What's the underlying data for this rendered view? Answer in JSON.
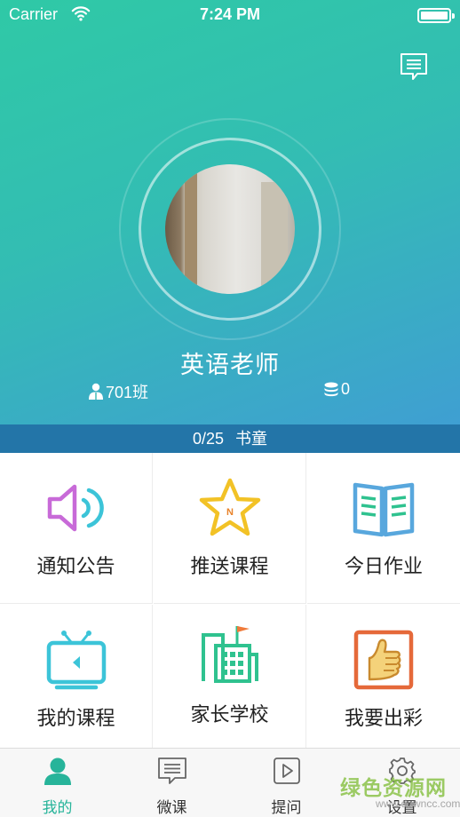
{
  "status_bar": {
    "carrier": "Carrier",
    "time": "7:24 PM"
  },
  "profile": {
    "name": "英语老师",
    "class_label": "701班",
    "coins": "0"
  },
  "progress": {
    "value": "0/25",
    "label": "书童"
  },
  "grid": [
    {
      "label": "通知公告",
      "icon": "speaker-icon"
    },
    {
      "label": "推送课程",
      "icon": "star-icon"
    },
    {
      "label": "今日作业",
      "icon": "open-book-icon"
    },
    {
      "label": "我的课程",
      "icon": "tv-icon"
    },
    {
      "label": "家长学校",
      "icon": "school-building-icon"
    },
    {
      "label": "我要出彩",
      "icon": "thumbs-up-icon"
    }
  ],
  "tabs": [
    {
      "label": "我的",
      "icon": "person-icon",
      "active": true
    },
    {
      "label": "微课",
      "icon": "message-icon",
      "active": false
    },
    {
      "label": "提问",
      "icon": "play-icon",
      "active": false
    },
    {
      "label": "设置",
      "icon": "gear-icon",
      "active": false
    }
  ],
  "watermark": {
    "text": "绿色资源网",
    "url": "www.downcc.com"
  },
  "colors": {
    "header_gradient_start": "#2fc9a6",
    "header_gradient_end": "#3f9fd2",
    "progress_strip": "#2375a8",
    "active_tab": "#27b49a"
  }
}
